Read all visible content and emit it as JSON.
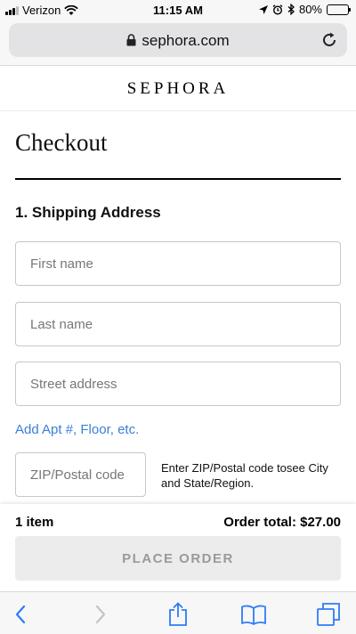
{
  "status_bar": {
    "carrier": "Verizon",
    "time": "11:15 AM",
    "battery_percent": "80%",
    "battery_level": 0.8,
    "icons": [
      "signal-bars-icon",
      "wifi-icon",
      "location-arrow-icon",
      "alarm-icon",
      "bluetooth-icon",
      "battery-icon"
    ]
  },
  "browser": {
    "url": "sephora.com",
    "icons": [
      "lock-icon",
      "reload-icon"
    ]
  },
  "header": {
    "brand": "SEPHORA"
  },
  "checkout": {
    "title": "Checkout",
    "section_heading": "1. Shipping Address",
    "fields": {
      "first_name_placeholder": "First name",
      "last_name_placeholder": "Last name",
      "street_placeholder": "Street address",
      "zip_placeholder": "ZIP/Postal code"
    },
    "add_apt_link": "Add Apt #, Floor, etc.",
    "zip_hint": "Enter ZIP/Postal code tosee City and State/Region."
  },
  "order": {
    "item_count": "1 item",
    "total": "Order total: $27.00",
    "place_order_label": "PLACE ORDER"
  },
  "toolbar": {
    "icons": [
      "back-icon",
      "forward-icon",
      "share-icon",
      "bookmarks-icon",
      "tabs-icon"
    ]
  },
  "colors": {
    "link": "#3a7fd5",
    "toolbar_icon": "#2d7cf6",
    "disabled_button_bg": "#ececec",
    "disabled_button_text": "#9a9a9a"
  }
}
